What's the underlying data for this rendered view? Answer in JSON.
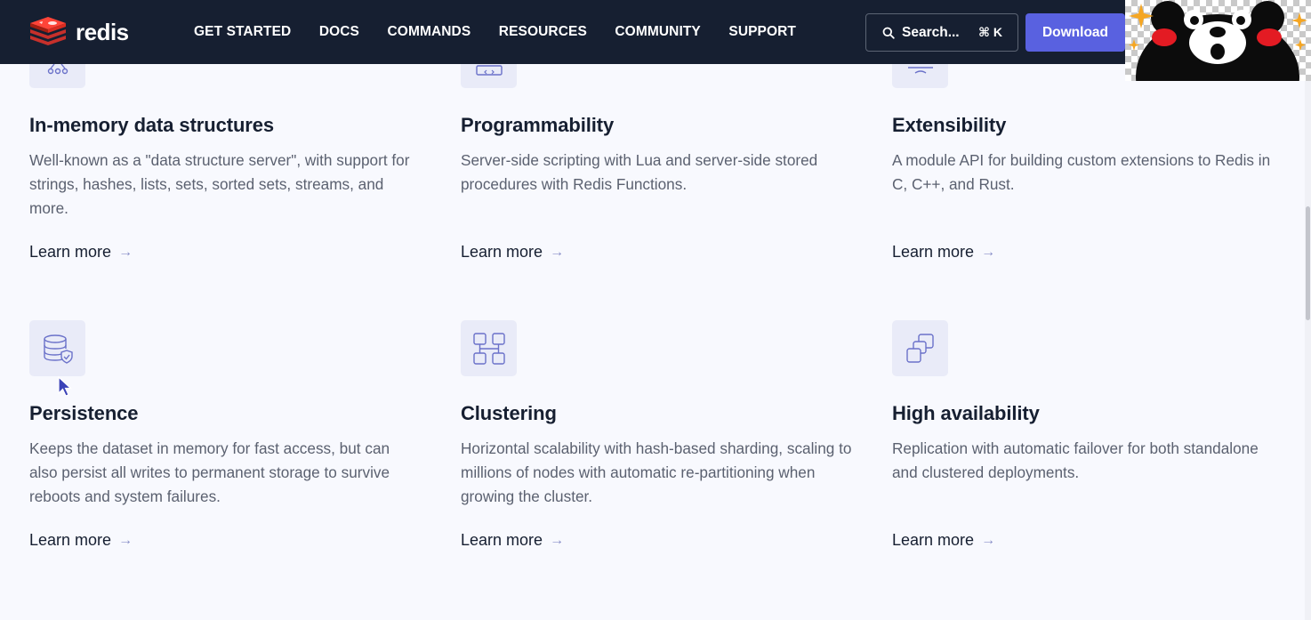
{
  "header": {
    "logo_text": "redis",
    "nav": [
      "GET STARTED",
      "DOCS",
      "COMMANDS",
      "RESOURCES",
      "COMMUNITY",
      "SUPPORT"
    ],
    "search": {
      "label": "Search...",
      "shortcut": "⌘ K"
    },
    "download_label": "Download"
  },
  "colors": {
    "header_bg": "#161f31",
    "brand_red": "#dc382c",
    "accent": "#5961e0",
    "icon_tile": "#e9ebf8",
    "icon_stroke": "#6a71c9"
  },
  "features": [
    {
      "icon": "data-structures-icon",
      "title": "In-memory data structures",
      "description": "Well-known as a \"data structure server\", with support for strings, hashes, lists, sets, sorted sets, streams, and more.",
      "link": "Learn more"
    },
    {
      "icon": "code-window-icon",
      "title": "Programmability",
      "description": "Server-side scripting with Lua and server-side stored procedures with Redis Functions.",
      "link": "Learn more"
    },
    {
      "icon": "monitor-icon",
      "title": "Extensibility",
      "description": "A module API for building custom extensions to Redis in C, C++, and Rust.",
      "link": "Learn more"
    },
    {
      "icon": "database-shield-icon",
      "title": "Persistence",
      "description": "Keeps the dataset in memory for fast access, but can also persist all writes to permanent storage to survive reboots and system failures.",
      "link": "Learn more"
    },
    {
      "icon": "cluster-nodes-icon",
      "title": "Clustering",
      "description": "Horizontal scalability with hash-based sharding, scaling to millions of nodes with automatic re-partitioning when growing the cluster.",
      "link": "Learn more"
    },
    {
      "icon": "replicas-icon",
      "title": "High availability",
      "description": "Replication with automatic failover for both standalone and clustered deployments.",
      "link": "Learn more"
    }
  ]
}
